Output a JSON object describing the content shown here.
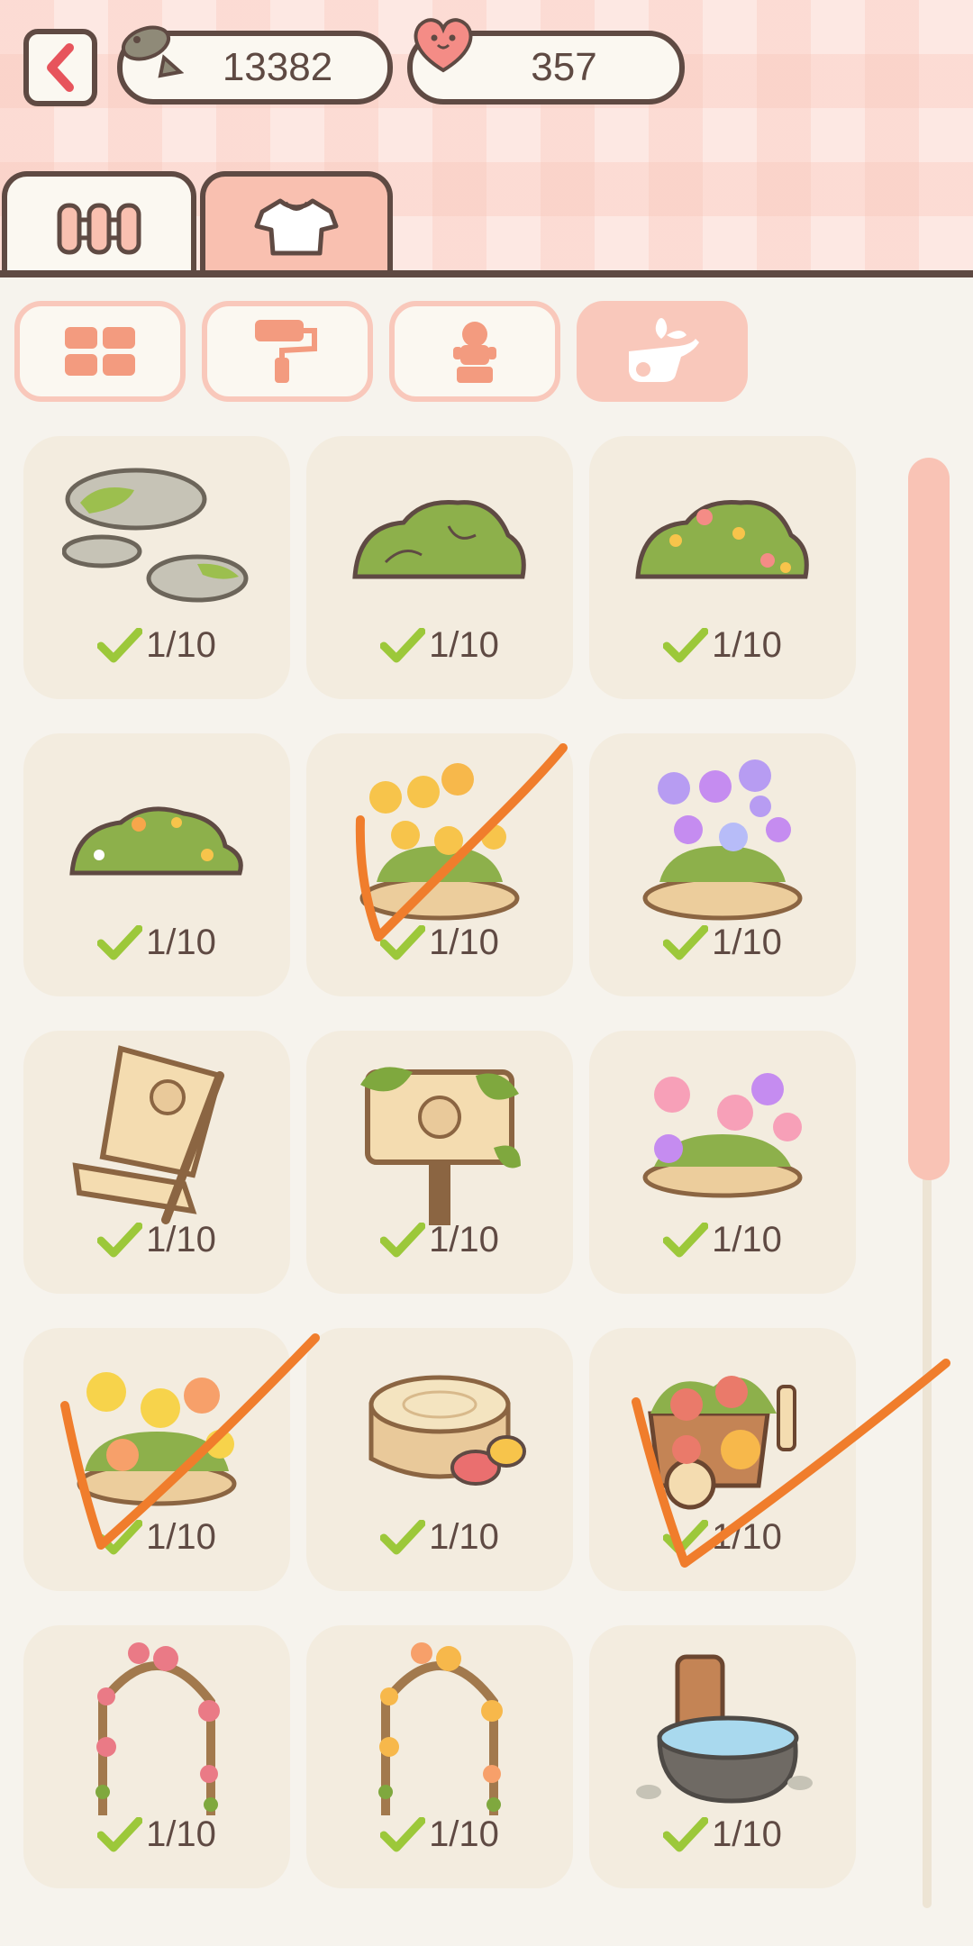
{
  "header": {
    "fish_count": "13382",
    "heart_count": "357"
  },
  "tabs": [
    {
      "icon": "fence-icon",
      "active": false
    },
    {
      "icon": "shirt-icon",
      "active": true
    }
  ],
  "categories": [
    {
      "icon": "grid-icon",
      "active": false
    },
    {
      "icon": "paint-roller-icon",
      "active": false
    },
    {
      "icon": "statue-icon",
      "active": false
    },
    {
      "icon": "watering-can-icon",
      "active": true
    }
  ],
  "items": [
    {
      "name": "stepping-stones",
      "count": "1/10"
    },
    {
      "name": "green-bush",
      "count": "1/10"
    },
    {
      "name": "flower-bush",
      "count": "1/10"
    },
    {
      "name": "small-flower-bush",
      "count": "1/10"
    },
    {
      "name": "yellow-flower-planter",
      "count": "1/10"
    },
    {
      "name": "purple-flower-planter",
      "count": "1/10"
    },
    {
      "name": "wooden-chair",
      "count": "1/10"
    },
    {
      "name": "flower-signpost",
      "count": "1/10"
    },
    {
      "name": "pink-flower-planter",
      "count": "1/10"
    },
    {
      "name": "yellow-orange-flower-planter",
      "count": "1/10"
    },
    {
      "name": "tree-stump",
      "count": "1/10"
    },
    {
      "name": "flower-cart",
      "count": "1/10"
    },
    {
      "name": "rose-arch",
      "count": "1/10"
    },
    {
      "name": "orange-rose-arch",
      "count": "1/10"
    },
    {
      "name": "water-basin",
      "count": "1/10"
    }
  ],
  "colors": {
    "outline": "#5f4a43",
    "accent_pink": "#f9c0b0",
    "check_green": "#9cc83a",
    "annotation_orange": "#f07d2c"
  }
}
